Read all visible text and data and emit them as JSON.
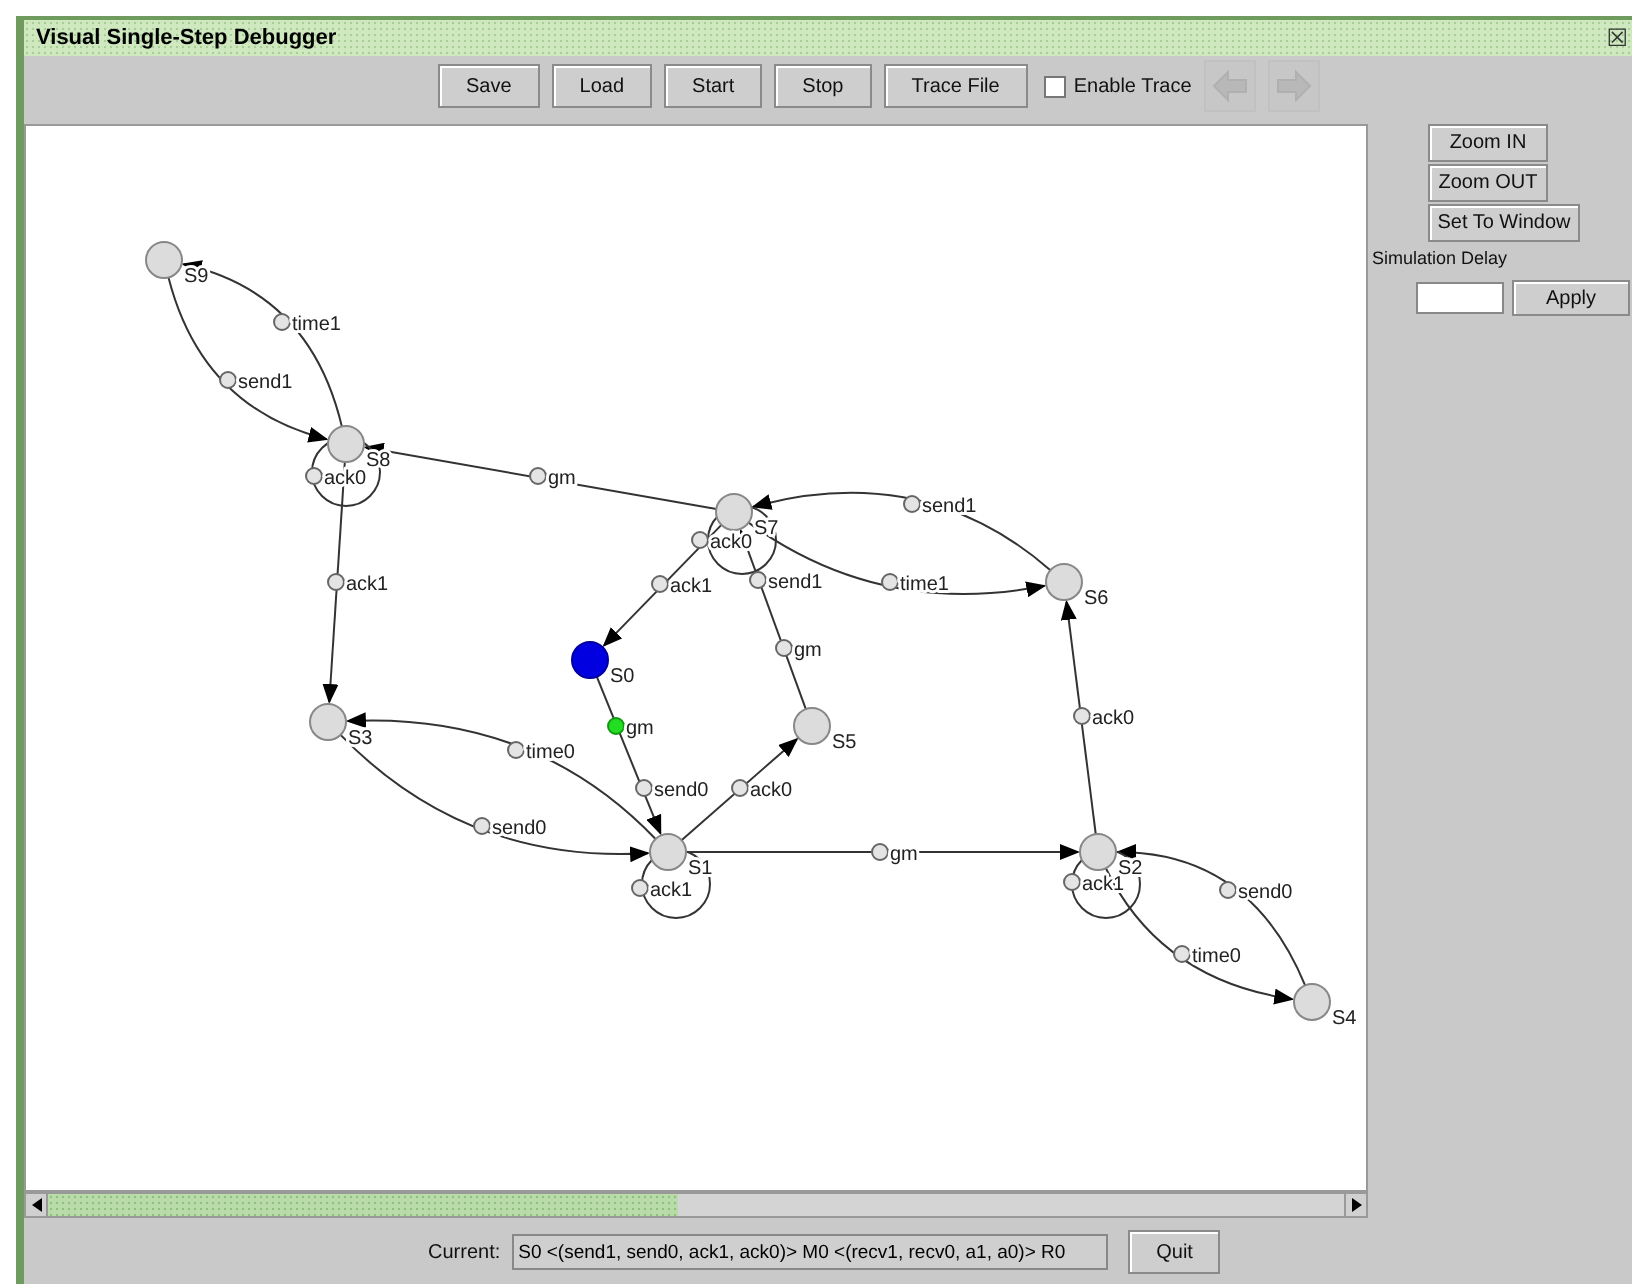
{
  "window": {
    "title": "Visual Single-Step Debugger",
    "close_glyph": "☒"
  },
  "toolbar": {
    "buttons": [
      "Save",
      "Load",
      "Start",
      "Stop",
      "Trace File"
    ],
    "enable_trace": {
      "label": "Enable Trace",
      "checked": false
    },
    "nav_buttons": [
      {
        "kind": "back",
        "disabled": true
      },
      {
        "kind": "forward",
        "disabled": true
      }
    ]
  },
  "graph": {
    "states": [
      {
        "label": "S9",
        "current": false
      },
      {
        "label": "S8",
        "current": false
      },
      {
        "label": "S7",
        "current": false
      },
      {
        "label": "S6",
        "current": false
      },
      {
        "label": "S0",
        "current": true
      },
      {
        "label": "S3",
        "current": false
      },
      {
        "label": "S5",
        "current": false
      },
      {
        "label": "S1",
        "current": false
      },
      {
        "label": "S2",
        "current": false
      },
      {
        "label": "S4",
        "current": false
      }
    ],
    "transitions": [
      {
        "label": "time1",
        "active": false
      },
      {
        "label": "send1",
        "active": false
      },
      {
        "label": "ack0",
        "active": false
      },
      {
        "label": "gm",
        "active": false
      },
      {
        "label": "send1",
        "active": false
      },
      {
        "label": "ack0",
        "active": false
      },
      {
        "label": "ack1",
        "active": false
      },
      {
        "label": "ack1",
        "active": false
      },
      {
        "label": "send1",
        "active": false
      },
      {
        "label": "time1",
        "active": false
      },
      {
        "label": "gm",
        "active": false
      },
      {
        "label": "gm",
        "active": true
      },
      {
        "label": "ack0",
        "active": false
      },
      {
        "label": "time0",
        "active": false
      },
      {
        "label": "send0",
        "active": false
      },
      {
        "label": "ack0",
        "active": false
      },
      {
        "label": "send0",
        "active": false
      },
      {
        "label": "gm",
        "active": false
      },
      {
        "label": "ack1",
        "active": false
      },
      {
        "label": "ack1",
        "active": false
      },
      {
        "label": "send0",
        "active": false
      },
      {
        "label": "time0",
        "active": false
      }
    ]
  },
  "side_panel": {
    "buttons": [
      "Zoom IN",
      "Zoom OUT",
      "Set To Window"
    ],
    "delay_label": "Simulation Delay",
    "apply": "Apply"
  },
  "status": {
    "label": "Current:",
    "value": "S0 <(send1, send0, ack1, ack0)> M0 <(recv1, recv0, a1, a0)> R0",
    "quit": "Quit"
  }
}
